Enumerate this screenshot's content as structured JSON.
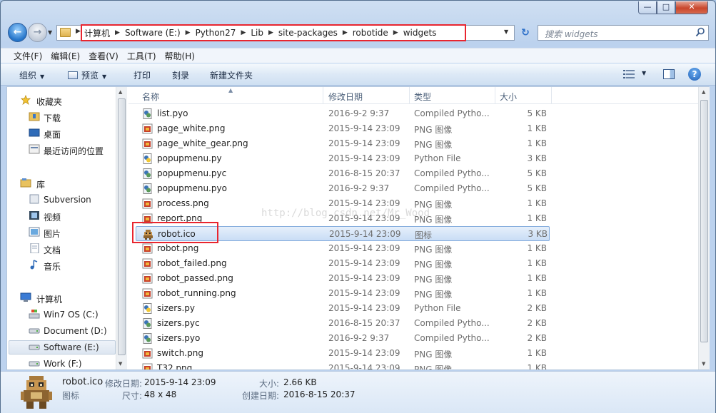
{
  "window": {
    "minimize_glyph": "—",
    "maximize_glyph": "□",
    "close_glyph": "✕"
  },
  "navigation": {
    "back_glyph": "←",
    "forward_glyph": "→",
    "breadcrumbs": [
      "计算机",
      "Software (E:)",
      "Python27",
      "Lib",
      "site-packages",
      "robotide",
      "widgets"
    ],
    "refresh_glyph": "↻"
  },
  "search": {
    "placeholder": "搜索 widgets"
  },
  "menu": [
    "文件(F)",
    "编辑(E)",
    "查看(V)",
    "工具(T)",
    "帮助(H)"
  ],
  "toolbar": {
    "organize": "组织",
    "preview": "预览",
    "print": "打印",
    "burn": "刻录",
    "new_folder": "新建文件夹",
    "help_glyph": "?"
  },
  "nav_pane": {
    "favorites_header": "收藏夹",
    "favorites": [
      "下载",
      "桌面",
      "最近访问的位置"
    ],
    "libraries_header": "库",
    "libraries": [
      "Subversion",
      "视频",
      "图片",
      "文档",
      "音乐"
    ],
    "computer_header": "计算机",
    "drives": [
      "Win7 OS (C:)",
      "Document (D:)",
      "Software (E:)",
      "Work (F:)"
    ],
    "selected_drive": "Software (E:)"
  },
  "columns": {
    "name": "名称",
    "modified": "修改日期",
    "type": "类型",
    "size": "大小"
  },
  "files": [
    {
      "name": "list.pyo",
      "modified": "2016-9-2 9:37",
      "type": "Compiled Pytho...",
      "size": "5 KB",
      "icon": "pyo-icon"
    },
    {
      "name": "page_white.png",
      "modified": "2015-9-14 23:09",
      "type": "PNG 图像",
      "size": "1 KB",
      "icon": "png-icon"
    },
    {
      "name": "page_white_gear.png",
      "modified": "2015-9-14 23:09",
      "type": "PNG 图像",
      "size": "1 KB",
      "icon": "png-icon"
    },
    {
      "name": "popupmenu.py",
      "modified": "2015-9-14 23:09",
      "type": "Python File",
      "size": "3 KB",
      "icon": "py-icon"
    },
    {
      "name": "popupmenu.pyc",
      "modified": "2016-8-15 20:37",
      "type": "Compiled Pytho...",
      "size": "5 KB",
      "icon": "pyc-icon"
    },
    {
      "name": "popupmenu.pyo",
      "modified": "2016-9-2 9:37",
      "type": "Compiled Pytho...",
      "size": "5 KB",
      "icon": "pyo-icon"
    },
    {
      "name": "process.png",
      "modified": "2015-9-14 23:09",
      "type": "PNG 图像",
      "size": "1 KB",
      "icon": "png-icon"
    },
    {
      "name": "report.png",
      "modified": "2015-9-14 23:09",
      "type": "PNG 图像",
      "size": "1 KB",
      "icon": "png-icon"
    },
    {
      "name": "robot.ico",
      "modified": "2015-9-14 23:09",
      "type": "图标",
      "size": "3 KB",
      "icon": "robot-icon"
    },
    {
      "name": "robot.png",
      "modified": "2015-9-14 23:09",
      "type": "PNG 图像",
      "size": "1 KB",
      "icon": "png-icon"
    },
    {
      "name": "robot_failed.png",
      "modified": "2015-9-14 23:09",
      "type": "PNG 图像",
      "size": "1 KB",
      "icon": "png-icon"
    },
    {
      "name": "robot_passed.png",
      "modified": "2015-9-14 23:09",
      "type": "PNG 图像",
      "size": "1 KB",
      "icon": "png-icon"
    },
    {
      "name": "robot_running.png",
      "modified": "2015-9-14 23:09",
      "type": "PNG 图像",
      "size": "1 KB",
      "icon": "png-icon"
    },
    {
      "name": "sizers.py",
      "modified": "2015-9-14 23:09",
      "type": "Python File",
      "size": "2 KB",
      "icon": "py-icon"
    },
    {
      "name": "sizers.pyc",
      "modified": "2016-8-15 20:37",
      "type": "Compiled Pytho...",
      "size": "2 KB",
      "icon": "pyc-icon"
    },
    {
      "name": "sizers.pyo",
      "modified": "2016-9-2 9:37",
      "type": "Compiled Pytho...",
      "size": "2 KB",
      "icon": "pyo-icon"
    },
    {
      "name": "switch.png",
      "modified": "2015-9-14 23:09",
      "type": "PNG 图像",
      "size": "1 KB",
      "icon": "png-icon"
    },
    {
      "name": "T32.png",
      "modified": "2015-9-14 23:09",
      "type": "PNG 图像",
      "size": "1 KB",
      "icon": "png-icon"
    }
  ],
  "selected_file_index": 8,
  "watermark": "http://blog.csdn.net/Mr_Wood",
  "details": {
    "name": "robot.ico",
    "kind": "图标",
    "modified_label": "修改日期:",
    "modified": "2015-9-14 23:09",
    "dimensions_label": "尺寸:",
    "dimensions": "48 x 48",
    "size_label": "大小:",
    "size": "2.66 KB",
    "created_label": "创建日期:",
    "created": "2016-8-15 20:37"
  },
  "colors": {
    "highlight": "#e8252f",
    "selection": "#c9ddf5",
    "accent": "#2474c9"
  }
}
